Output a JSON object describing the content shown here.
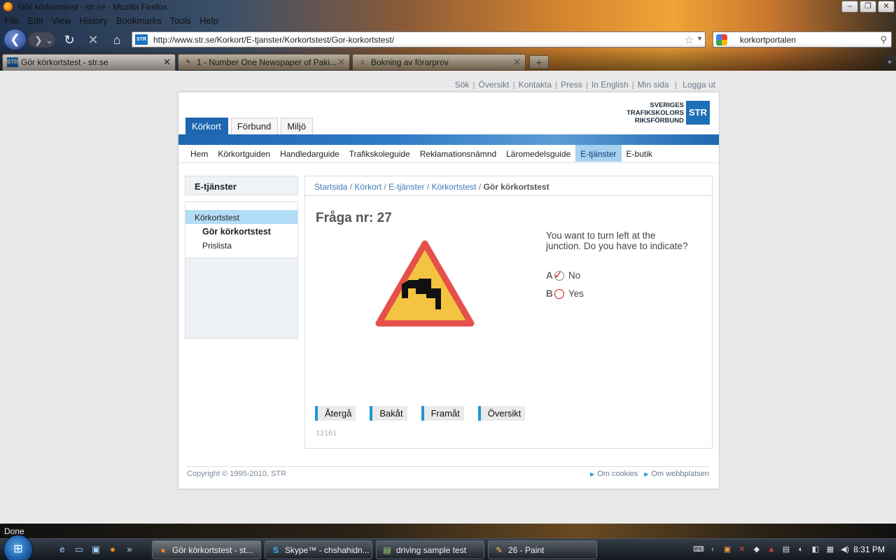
{
  "window": {
    "title": "Gör körkortstest - str.se - Mozilla Firefox",
    "controls": [
      "–",
      "❐",
      "✕"
    ]
  },
  "menubar": [
    "File",
    "Edit",
    "View",
    "History",
    "Bookmarks",
    "Tools",
    "Help"
  ],
  "navbar": {
    "url": "http://www.str.se/Korkort/E-tjanster/Korkortstest/Gor-korkortstest/",
    "site_badge": "STR",
    "search_value": "korkortportalen"
  },
  "tabs": [
    {
      "label": "Gör körkortstest - str.se",
      "icon": "STR"
    },
    {
      "label": "1 - Number One Newspaper of Paki...",
      "icon": "✎"
    },
    {
      "label": "Bokning av förarprov",
      "icon": "▯"
    }
  ],
  "new_tab": "+",
  "site": {
    "toplinks": [
      "Sök",
      "Översikt",
      "Kontakta",
      "Press",
      "In English",
      "Min sida",
      "Logga ut"
    ],
    "logo": {
      "line1": "SVERIGES",
      "line2": "TRAFIKSKOLORS",
      "line3": "RIKSFÖRBUND",
      "box": "STR"
    },
    "main_tabs": [
      "Körkort",
      "Förbund",
      "Miljö"
    ],
    "subnav": [
      "Hem",
      "Körkortguiden",
      "Handledarguide",
      "Trafikskoleguide",
      "Reklamationsnämnd",
      "Läromedelsguide",
      "E-tjänster",
      "E-butik"
    ],
    "sidebar": {
      "heading": "E-tjänster",
      "items": [
        "Körkortstest",
        "Gör körkortstest",
        "Prislista"
      ]
    },
    "breadcrumb": {
      "links": [
        "Startsida",
        "Körkort",
        "E-tjänster",
        "Körkortstest"
      ],
      "separator": "/",
      "current": "Gör körkortstest"
    },
    "question": {
      "title": "Fråga nr: 27",
      "text": "You want to turn left at the junction. Do you have to indicate?",
      "answers": [
        {
          "letter": "A",
          "label": "No"
        },
        {
          "letter": "B",
          "label": "Yes"
        }
      ],
      "buttons": [
        "Återgå",
        "Bakåt",
        "Framåt",
        "Översikt"
      ],
      "code": "12161"
    },
    "footer": {
      "copyright": "Copyright © 1995-2010, STR",
      "links": [
        "Om cookies",
        "Om webbplatsen"
      ]
    }
  },
  "statusbar": {
    "text": "Done"
  },
  "taskbar": {
    "tasks": [
      {
        "label": "Gör körkortstest - st...",
        "icon": "●"
      },
      {
        "label": "Skype™ - chshahidn...",
        "icon": "S"
      },
      {
        "label": "driving sample test",
        "icon": "▤"
      },
      {
        "label": "26 - Paint",
        "icon": "✎"
      }
    ],
    "clock": "8:31 PM",
    "quick_launch": [
      "e",
      "▭",
      "▣",
      "●",
      "»"
    ],
    "tray": [
      "⌨",
      "‹",
      "▣",
      "✕",
      "◆",
      "▲",
      "▤",
      "◐",
      "◧",
      "▦",
      "◀)"
    ]
  },
  "colors": {
    "brand_blue": "#1e66b0",
    "active_subnav": "#a6d1f1",
    "sign_red": "#e5504a",
    "sign_yellow": "#f4c441"
  }
}
